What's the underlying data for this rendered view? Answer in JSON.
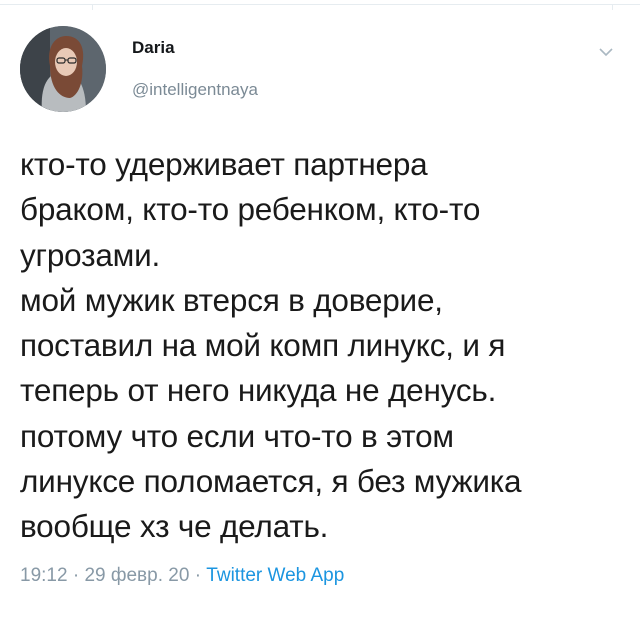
{
  "tweet": {
    "author_name": "Daria",
    "author_handle": "@intelligentnaya",
    "text": "кто-то удерживает партнера\nбраком, кто-то ребенком, кто-то\nугрозами.\nмой мужик втерся в доверие,\nпоставил на мой комп линукс, и я\nтеперь от него никуда не денусь.\nпотому что если что-то в этом\nлинуксе поломается, я без мужика\nвообще хз че делать.",
    "time": "19:12",
    "date": "29 февр. 20",
    "separator": "·",
    "source": "Twitter Web App"
  },
  "icons": {
    "menu": "chevron-down-icon",
    "avatar": "avatar"
  },
  "colors": {
    "text": "#1a1a1a",
    "muted": "#8899a6",
    "link": "#1b95e0"
  }
}
